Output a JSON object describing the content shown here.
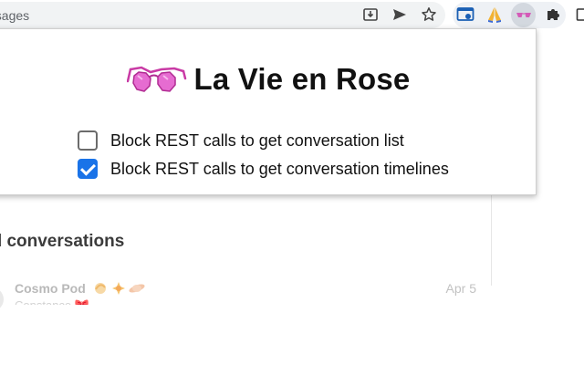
{
  "browser": {
    "omnibox_text": "essages",
    "toolbar_icons": [
      "install-app-icon",
      "send-tab-icon",
      "bookmark-star-icon"
    ],
    "extension_icons": [
      "screenshot-icon",
      "praying-hands-icon",
      "sunglasses-icon",
      "puzzle-icon",
      "side-panel-icon"
    ]
  },
  "popup": {
    "title": "La Vie en Rose",
    "logo_icon": "pink-sunglasses-icon",
    "options": [
      {
        "label": "Block REST calls to get conversation list",
        "checked": false
      },
      {
        "label": "Block REST calls to get conversation timelines",
        "checked": true
      }
    ],
    "accent_color": "#1a73e8"
  },
  "page": {
    "section_heading": "ed conversations",
    "conversations": [
      {
        "name": "Cosmo Pod",
        "date": "Apr 5",
        "preview": "Constance 🎀 · · · · ·"
      }
    ]
  }
}
